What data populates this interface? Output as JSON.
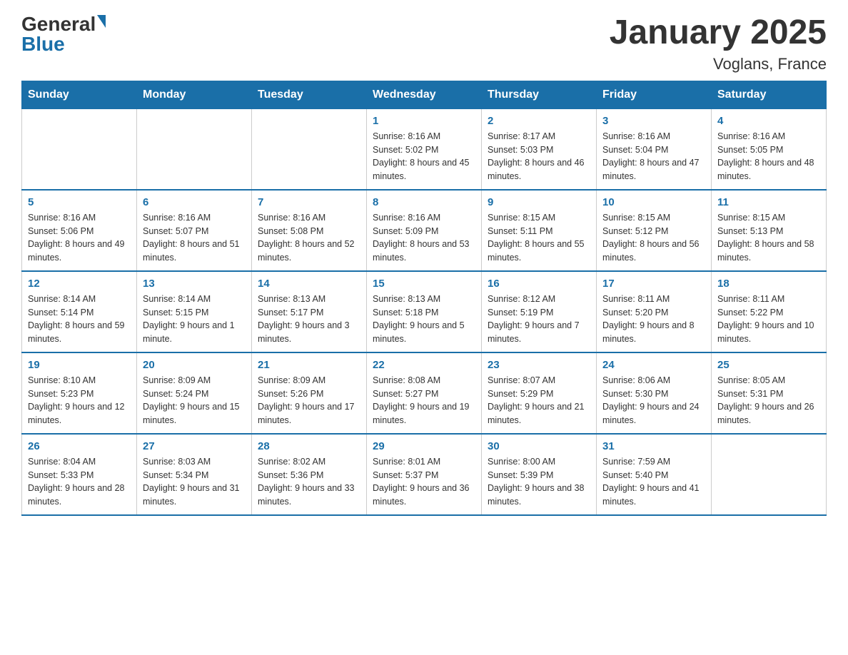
{
  "header": {
    "logo": {
      "general": "General",
      "triangle": "",
      "blue": "Blue"
    },
    "title": "January 2025",
    "subtitle": "Voglans, France"
  },
  "days_of_week": [
    "Sunday",
    "Monday",
    "Tuesday",
    "Wednesday",
    "Thursday",
    "Friday",
    "Saturday"
  ],
  "weeks": [
    [
      null,
      null,
      null,
      {
        "day": "1",
        "sunrise": "8:16 AM",
        "sunset": "5:02 PM",
        "daylight": "8 hours and 45 minutes."
      },
      {
        "day": "2",
        "sunrise": "8:17 AM",
        "sunset": "5:03 PM",
        "daylight": "8 hours and 46 minutes."
      },
      {
        "day": "3",
        "sunrise": "8:16 AM",
        "sunset": "5:04 PM",
        "daylight": "8 hours and 47 minutes."
      },
      {
        "day": "4",
        "sunrise": "8:16 AM",
        "sunset": "5:05 PM",
        "daylight": "8 hours and 48 minutes."
      }
    ],
    [
      {
        "day": "5",
        "sunrise": "8:16 AM",
        "sunset": "5:06 PM",
        "daylight": "8 hours and 49 minutes."
      },
      {
        "day": "6",
        "sunrise": "8:16 AM",
        "sunset": "5:07 PM",
        "daylight": "8 hours and 51 minutes."
      },
      {
        "day": "7",
        "sunrise": "8:16 AM",
        "sunset": "5:08 PM",
        "daylight": "8 hours and 52 minutes."
      },
      {
        "day": "8",
        "sunrise": "8:16 AM",
        "sunset": "5:09 PM",
        "daylight": "8 hours and 53 minutes."
      },
      {
        "day": "9",
        "sunrise": "8:15 AM",
        "sunset": "5:11 PM",
        "daylight": "8 hours and 55 minutes."
      },
      {
        "day": "10",
        "sunrise": "8:15 AM",
        "sunset": "5:12 PM",
        "daylight": "8 hours and 56 minutes."
      },
      {
        "day": "11",
        "sunrise": "8:15 AM",
        "sunset": "5:13 PM",
        "daylight": "8 hours and 58 minutes."
      }
    ],
    [
      {
        "day": "12",
        "sunrise": "8:14 AM",
        "sunset": "5:14 PM",
        "daylight": "8 hours and 59 minutes."
      },
      {
        "day": "13",
        "sunrise": "8:14 AM",
        "sunset": "5:15 PM",
        "daylight": "9 hours and 1 minute."
      },
      {
        "day": "14",
        "sunrise": "8:13 AM",
        "sunset": "5:17 PM",
        "daylight": "9 hours and 3 minutes."
      },
      {
        "day": "15",
        "sunrise": "8:13 AM",
        "sunset": "5:18 PM",
        "daylight": "9 hours and 5 minutes."
      },
      {
        "day": "16",
        "sunrise": "8:12 AM",
        "sunset": "5:19 PM",
        "daylight": "9 hours and 7 minutes."
      },
      {
        "day": "17",
        "sunrise": "8:11 AM",
        "sunset": "5:20 PM",
        "daylight": "9 hours and 8 minutes."
      },
      {
        "day": "18",
        "sunrise": "8:11 AM",
        "sunset": "5:22 PM",
        "daylight": "9 hours and 10 minutes."
      }
    ],
    [
      {
        "day": "19",
        "sunrise": "8:10 AM",
        "sunset": "5:23 PM",
        "daylight": "9 hours and 12 minutes."
      },
      {
        "day": "20",
        "sunrise": "8:09 AM",
        "sunset": "5:24 PM",
        "daylight": "9 hours and 15 minutes."
      },
      {
        "day": "21",
        "sunrise": "8:09 AM",
        "sunset": "5:26 PM",
        "daylight": "9 hours and 17 minutes."
      },
      {
        "day": "22",
        "sunrise": "8:08 AM",
        "sunset": "5:27 PM",
        "daylight": "9 hours and 19 minutes."
      },
      {
        "day": "23",
        "sunrise": "8:07 AM",
        "sunset": "5:29 PM",
        "daylight": "9 hours and 21 minutes."
      },
      {
        "day": "24",
        "sunrise": "8:06 AM",
        "sunset": "5:30 PM",
        "daylight": "9 hours and 24 minutes."
      },
      {
        "day": "25",
        "sunrise": "8:05 AM",
        "sunset": "5:31 PM",
        "daylight": "9 hours and 26 minutes."
      }
    ],
    [
      {
        "day": "26",
        "sunrise": "8:04 AM",
        "sunset": "5:33 PM",
        "daylight": "9 hours and 28 minutes."
      },
      {
        "day": "27",
        "sunrise": "8:03 AM",
        "sunset": "5:34 PM",
        "daylight": "9 hours and 31 minutes."
      },
      {
        "day": "28",
        "sunrise": "8:02 AM",
        "sunset": "5:36 PM",
        "daylight": "9 hours and 33 minutes."
      },
      {
        "day": "29",
        "sunrise": "8:01 AM",
        "sunset": "5:37 PM",
        "daylight": "9 hours and 36 minutes."
      },
      {
        "day": "30",
        "sunrise": "8:00 AM",
        "sunset": "5:39 PM",
        "daylight": "9 hours and 38 minutes."
      },
      {
        "day": "31",
        "sunrise": "7:59 AM",
        "sunset": "5:40 PM",
        "daylight": "9 hours and 41 minutes."
      },
      null
    ]
  ]
}
